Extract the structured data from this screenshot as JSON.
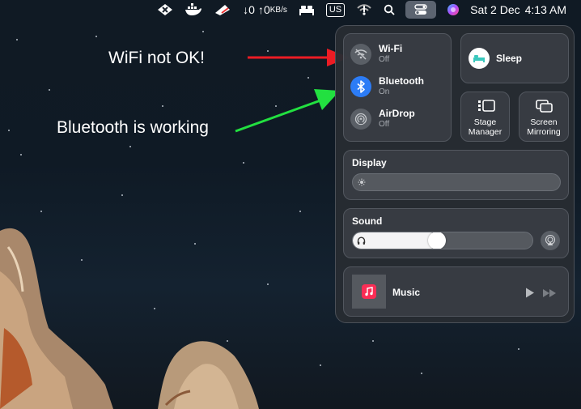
{
  "menubar": {
    "speed_down": "↓0",
    "speed_up": "↑0",
    "speed_unit": "KB/s",
    "input_source": "US",
    "date": "Sat 2 Dec",
    "time": "4:13 AM"
  },
  "annotations": {
    "wifi_note": "WiFi not OK!",
    "bluetooth_note": "Bluetooth is working",
    "wifi_arrow_color": "#ec1c24",
    "bluetooth_arrow_color": "#22e040"
  },
  "control_center": {
    "connectivity": {
      "wifi": {
        "title": "Wi-Fi",
        "status": "Off"
      },
      "bluetooth": {
        "title": "Bluetooth",
        "status": "On"
      },
      "airdrop": {
        "title": "AirDrop",
        "status": "Off"
      }
    },
    "focus": {
      "label": "Sleep"
    },
    "stage_manager": {
      "label_line1": "Stage",
      "label_line2": "Manager"
    },
    "screen_mirroring": {
      "label_line1": "Screen",
      "label_line2": "Mirroring"
    },
    "display": {
      "title": "Display",
      "brightness": 0
    },
    "sound": {
      "title": "Sound",
      "volume": 0.47
    },
    "music": {
      "title": "Music"
    }
  },
  "colors": {
    "bluetooth_accent": "#2c7cf6",
    "sleep_accent": "#3ac8bd",
    "music_accent": "#fa2d55"
  }
}
